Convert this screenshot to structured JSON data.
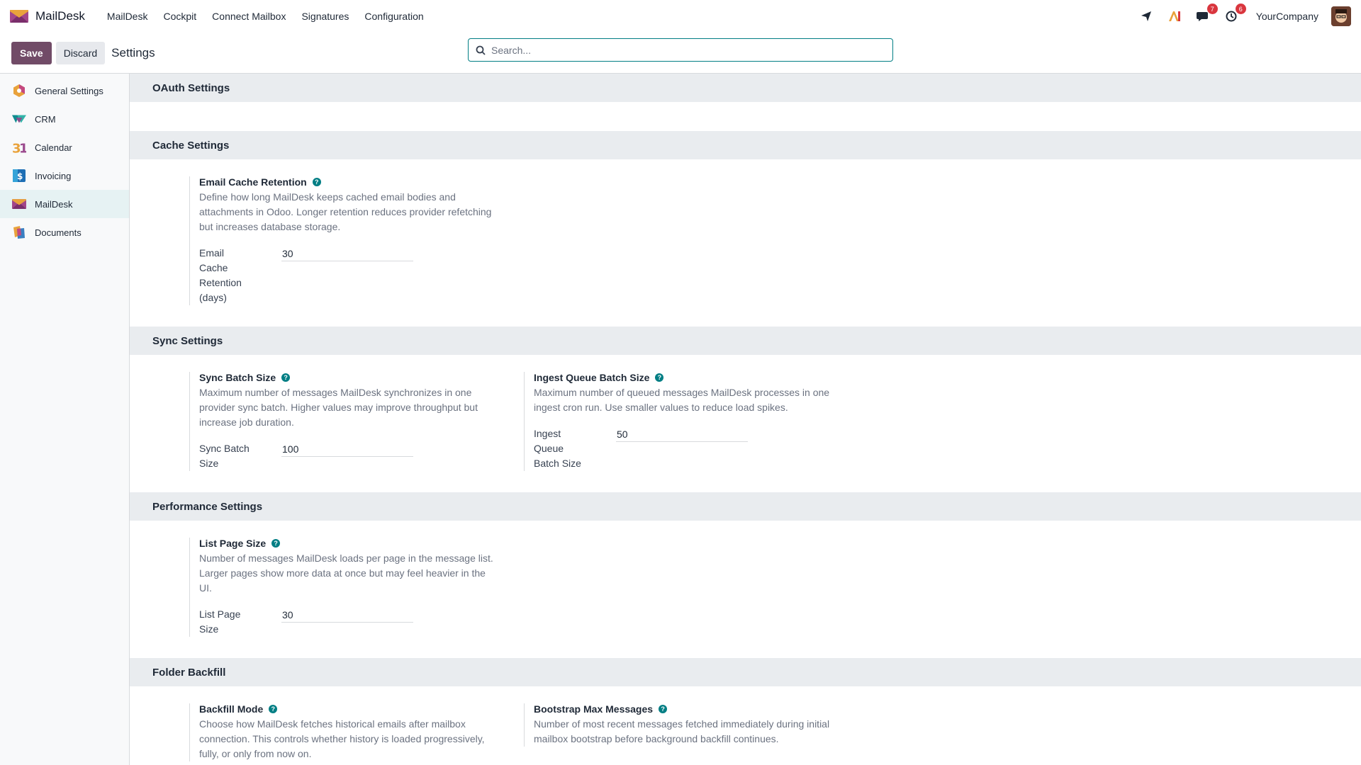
{
  "navbar": {
    "brand": "MailDesk",
    "menu": [
      "MailDesk",
      "Cockpit",
      "Connect Mailbox",
      "Signatures",
      "Configuration"
    ],
    "chat_count": "7",
    "activity_count": "6",
    "company": "YourCompany"
  },
  "control": {
    "save_label": "Save",
    "discard_label": "Discard",
    "title": "Settings",
    "search_placeholder": "Search..."
  },
  "sidebar": {
    "items": [
      {
        "label": "General Settings",
        "icon": "general-settings-icon"
      },
      {
        "label": "CRM",
        "icon": "crm-icon"
      },
      {
        "label": "Calendar",
        "icon": "calendar-icon"
      },
      {
        "label": "Invoicing",
        "icon": "invoicing-icon"
      },
      {
        "label": "MailDesk",
        "icon": "maildesk-icon"
      },
      {
        "label": "Documents",
        "icon": "documents-icon"
      }
    ]
  },
  "sections": {
    "oauth": {
      "title": "OAuth Settings"
    },
    "cache": {
      "title": "Cache Settings",
      "retention": {
        "title": "Email Cache Retention",
        "desc": "Define how long MailDesk keeps cached email bodies and attachments in Odoo. Longer retention reduces provider refetching but increases database storage.",
        "field_label": "Email Cache Retention (days)",
        "value": "30"
      }
    },
    "sync": {
      "title": "Sync Settings",
      "batch": {
        "title": "Sync Batch Size",
        "desc": "Maximum number of messages MailDesk synchronizes in one provider sync batch. Higher values may improve throughput but increase job duration.",
        "field_label": "Sync Batch Size",
        "value": "100"
      },
      "ingest": {
        "title": "Ingest Queue Batch Size",
        "desc": "Maximum number of queued messages MailDesk processes in one ingest cron run. Use smaller values to reduce load spikes.",
        "field_label": "Ingest Queue Batch Size",
        "value": "50"
      }
    },
    "performance": {
      "title": "Performance Settings",
      "page_size": {
        "title": "List Page Size",
        "desc": "Number of messages MailDesk loads per page in the message list. Larger pages show more data at once but may feel heavier in the UI.",
        "field_label": "List Page Size",
        "value": "30"
      }
    },
    "backfill": {
      "title": "Folder Backfill",
      "mode": {
        "title": "Backfill Mode",
        "desc": "Choose how MailDesk fetches historical emails after mailbox connection. This controls whether history is loaded progressively, fully, or only from now on."
      },
      "bootstrap": {
        "title": "Bootstrap Max Messages",
        "desc": "Number of most recent messages fetched immediately during initial mailbox bootstrap before background backfill continues."
      }
    }
  },
  "colors": {
    "primary": "#714b67",
    "accent": "#017e84",
    "section_bg": "#e9ecef"
  }
}
